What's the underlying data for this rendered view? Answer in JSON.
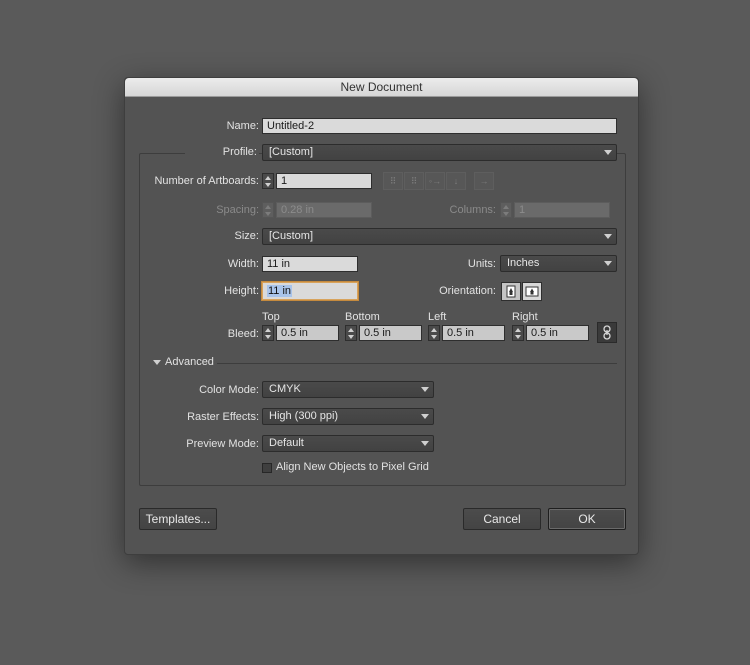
{
  "dialog": {
    "title": "New Document",
    "name_label": "Name:",
    "name_value": "Untitled-2",
    "profile_label": "Profile:",
    "profile_value": "[Custom]",
    "artboards_label": "Number of Artboards:",
    "artboards_value": "1",
    "spacing_label": "Spacing:",
    "spacing_value": "0.28 in",
    "columns_label": "Columns:",
    "columns_value": "1",
    "size_label": "Size:",
    "size_value": "[Custom]",
    "width_label": "Width:",
    "width_value": "11 in",
    "units_label": "Units:",
    "units_value": "Inches",
    "height_label": "Height:",
    "height_value": "11 in",
    "orientation_label": "Orientation:",
    "bleed_label": "Bleed:",
    "bleed": {
      "top_label": "Top",
      "top_value": "0.5 in",
      "bottom_label": "Bottom",
      "bottom_value": "0.5 in",
      "left_label": "Left",
      "left_value": "0.5 in",
      "right_label": "Right",
      "right_value": "0.5 in"
    },
    "advanced_label": "Advanced",
    "color_mode_label": "Color Mode:",
    "color_mode_value": "CMYK",
    "raster_label": "Raster Effects:",
    "raster_value": "High (300 ppi)",
    "preview_label": "Preview Mode:",
    "preview_value": "Default",
    "align_label": "Align New Objects to Pixel Grid",
    "align_checked": false,
    "templates_button": "Templates...",
    "cancel_button": "Cancel",
    "ok_button": "OK"
  },
  "icons": {
    "artboard_layout": [
      "grid-by-row-icon",
      "grid-by-column-icon",
      "arrange-by-row-icon",
      "arrange-by-column-icon",
      "right-to-left-icon"
    ],
    "orientation": [
      "portrait-icon",
      "landscape-icon"
    ],
    "bleed_link": "chain-link-icon"
  },
  "colors": {
    "background": "#5a5a5a",
    "dialog": "#535353",
    "focus": "#d8a35c"
  }
}
